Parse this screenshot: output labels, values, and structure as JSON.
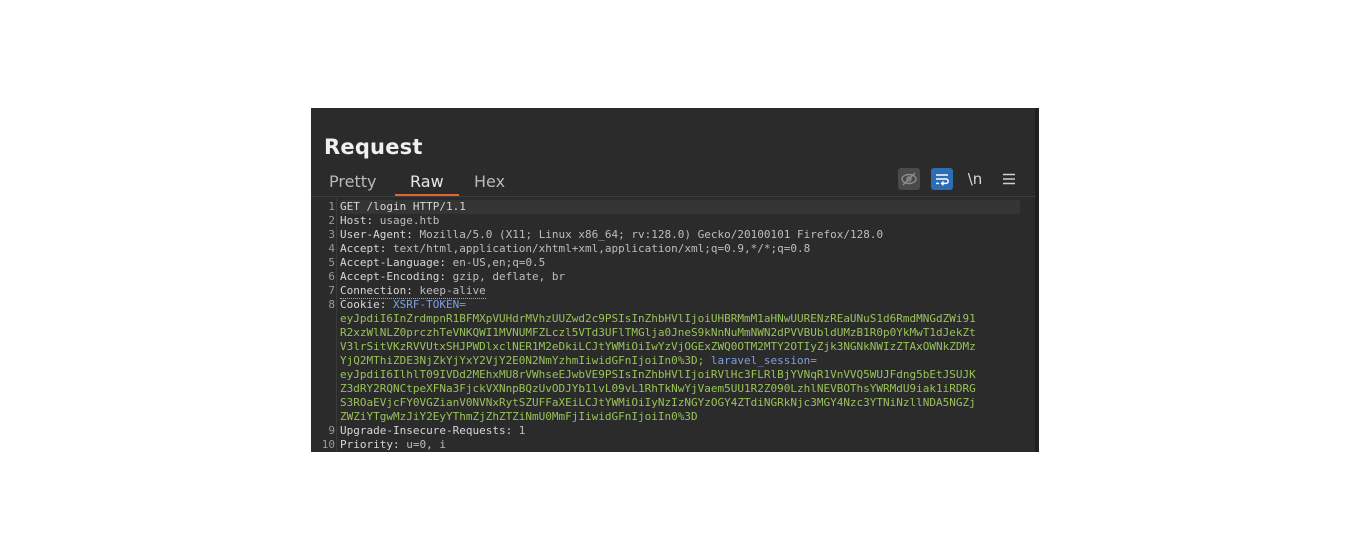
{
  "panel": {
    "title": "Request",
    "tabs": [
      {
        "label": "Pretty",
        "active": false
      },
      {
        "label": "Raw",
        "active": true
      },
      {
        "label": "Hex",
        "active": false
      }
    ],
    "toolbar": {
      "newline_label": "\\n",
      "icons": [
        "eye-off-icon",
        "wrap-icon",
        "newline-icon",
        "menu-icon"
      ],
      "accent_color": "#e0672f",
      "wrap_active_color": "#2e6db4"
    }
  },
  "request": {
    "lines": [
      {
        "num": "1",
        "name": "GET /login HTTP/1.1",
        "value": ""
      },
      {
        "num": "2",
        "name": "Host:",
        "value": " usage.htb"
      },
      {
        "num": "3",
        "name": "User-Agent:",
        "value": " Mozilla/5.0 (X11; Linux x86_64; rv:128.0) Gecko/20100101 Firefox/128.0"
      },
      {
        "num": "4",
        "name": "Accept:",
        "value": " text/html,application/xhtml+xml,application/xml;q=0.9,*/*;q=0.8"
      },
      {
        "num": "5",
        "name": "Accept-Language:",
        "value": " en-US,en;q=0.5"
      },
      {
        "num": "6",
        "name": "Accept-Encoding:",
        "value": " gzip, deflate, br"
      },
      {
        "num": "7",
        "name": "Connection:",
        "value": " keep-alive"
      },
      {
        "num": "8",
        "name": "Cookie:",
        "value": " "
      },
      {
        "num": "9",
        "name": "Upgrade-Insecure-Requests:",
        "value": " 1"
      },
      {
        "num": "10",
        "name": "Priority:",
        "value": " u=0, i"
      }
    ],
    "cookie": {
      "xsrf_key": "XSRF-TOKEN=",
      "xsrf_lines": [
        "eyJpdiI6InZrdmpnR1BFMXpVUHdrMVhzUUZwd2c9PSIsInZhbHVlIjoiUHBRMmM1aHNwUURENzREaUNuS1d6RmdMNGdZWi91",
        "R2xzWlNLZ0prczhTeVNKQWI1MVNUMFZLczl5VTd3UFlTMGlja0JneS9kNnNuMmNWN2dPVVBUbldUMzB1R0p0YkMwT1dJekZt",
        "V3lrSitVKzRVVUtxSHJPWDlxclNER1M2eDkiLCJtYWMiOiIwYzVjOGExZWQ0OTM2MTY2OTIyZjk3NGNkNWIzZTAxOWNkZDMz",
        "YjQ2MThiZDE3NjZkYjYxY2VjY2E0N2NmYzhmIiwidGFnIjoiIn0%3D;"
      ],
      "laravel_key": "laravel_session=",
      "laravel_lines": [
        "eyJpdiI6IlhlT09IVDd2MEhxMU8rVWhseEJwbVE9PSIsInZhbHVlIjoiRVlHc3FLRlBjYVNqR1VnVVQ5WUJFdng5bEtJSUJK",
        "Z3dRY2RQNCtpeXFNa3FjckVXNnpBQzUvODJYb1lvL09vL1RhTkNwYjVaem5UU1R2Z090LzhlNEVBOThsYWRMdU9iak1iRDRG",
        "S3ROaEVjcFY0VGZianV0NVNxRytSZUFFaXEiLCJtYWMiOiIyNzIzNGYzOGY4ZTdiNGRkNjc3MGY4Nzc3YTNiNzllNDA5NGZj",
        "ZWZiYTgwMzJiY2EyYThmZjZhZTZiNmU0MmFjIiwidGFnIjoiIn0%3D"
      ]
    }
  }
}
